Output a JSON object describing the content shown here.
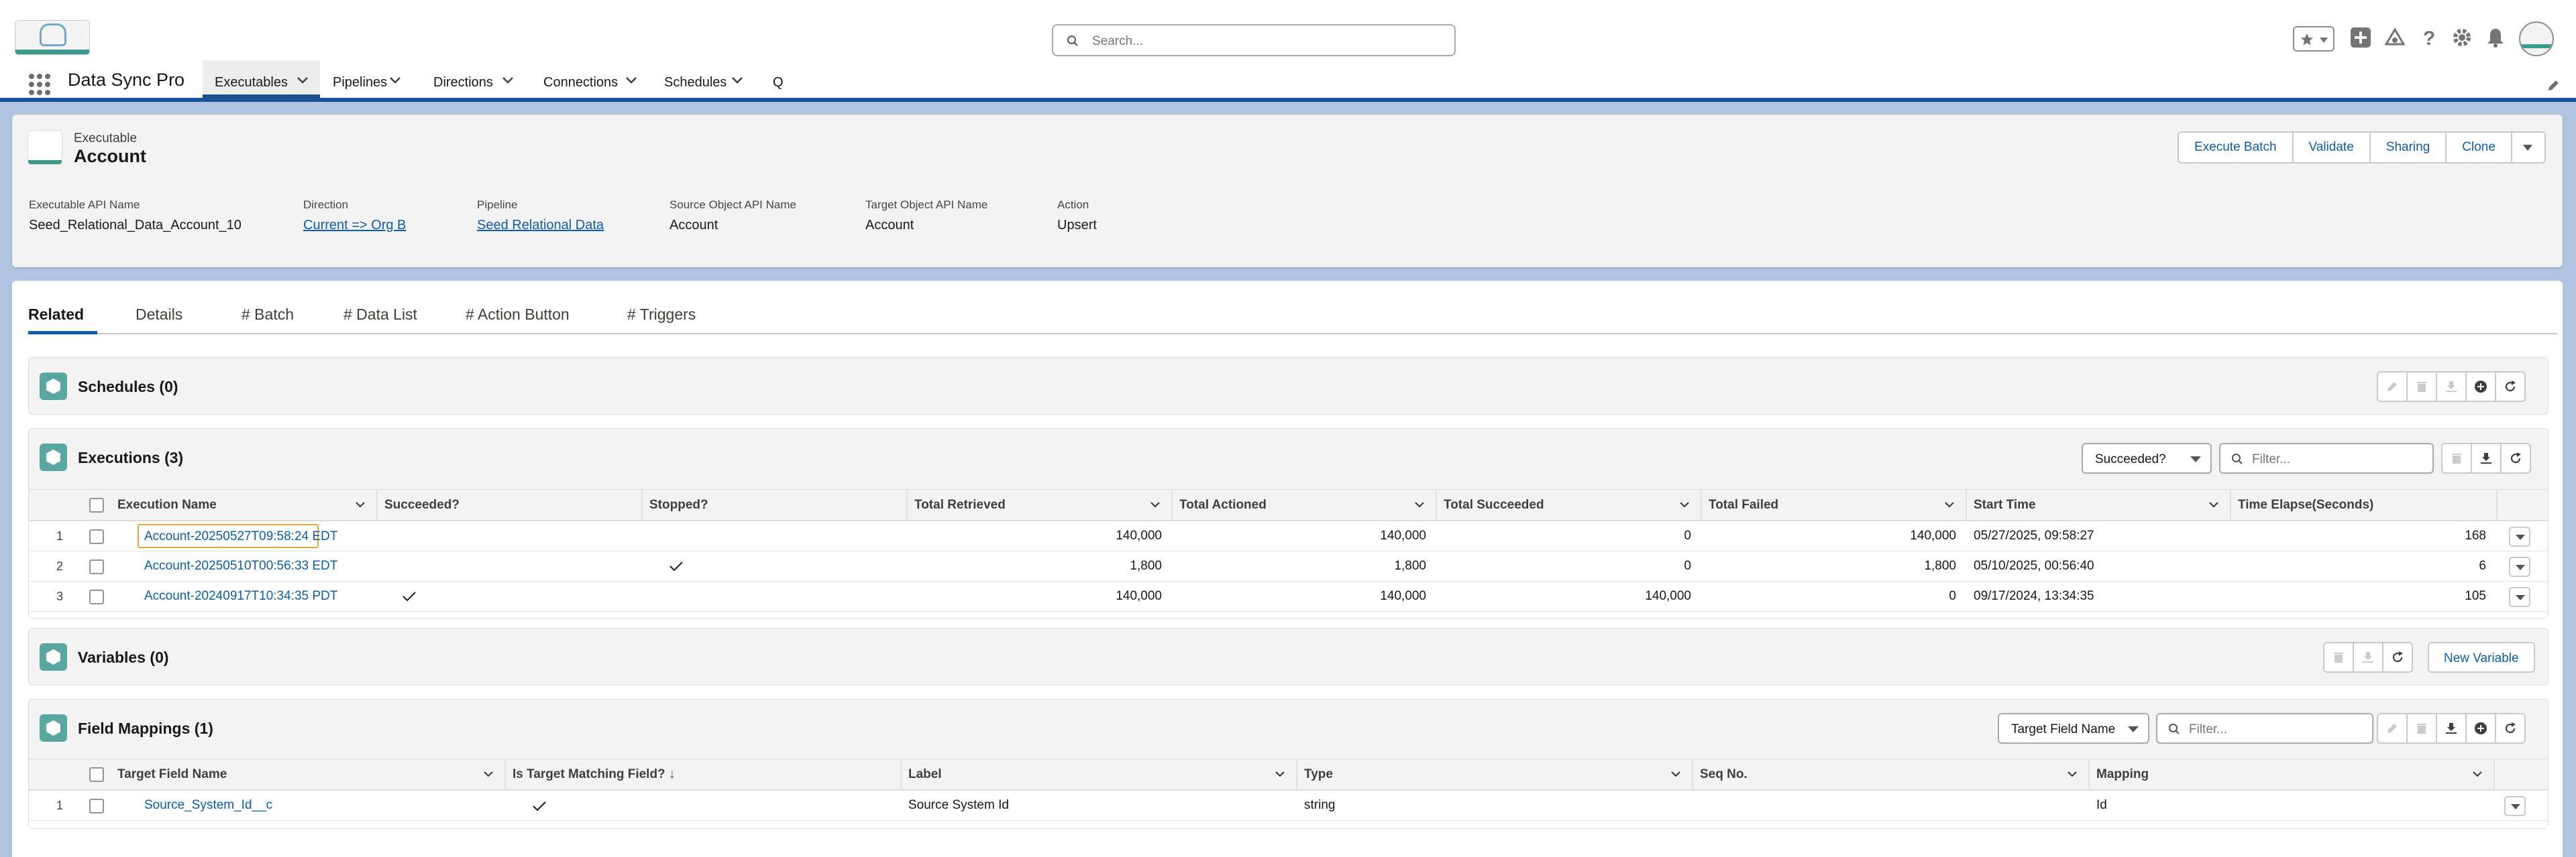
{
  "global_header": {
    "search_placeholder": "Search...",
    "icons": [
      "favorites-star-icon",
      "add-icon",
      "trailhead-icon",
      "help-icon",
      "setup-gear-icon",
      "notifications-bell-icon",
      "user-avatar"
    ]
  },
  "nav": {
    "app_name": "Data Sync Pro",
    "items": [
      {
        "label": "Executables",
        "active": true
      },
      {
        "label": "Pipelines"
      },
      {
        "label": "Directions"
      },
      {
        "label": "Connections"
      },
      {
        "label": "Schedules"
      },
      {
        "label": "Q"
      }
    ]
  },
  "record": {
    "type_label": "Executable",
    "title": "Account",
    "actions": [
      "Execute Batch",
      "Validate",
      "Sharing",
      "Clone"
    ],
    "fields": [
      {
        "label": "Executable API Name",
        "value": "Seed_Relational_Data_Account_10"
      },
      {
        "label": "Direction",
        "value": "Current => Org B",
        "link": true
      },
      {
        "label": "Pipeline",
        "value": "Seed Relational Data",
        "link": true
      },
      {
        "label": "Source Object API Name",
        "value": "Account"
      },
      {
        "label": "Target Object API Name",
        "value": "Account"
      },
      {
        "label": "Action",
        "value": "Upsert"
      }
    ]
  },
  "tabs": [
    "Related",
    "Details",
    "# Batch",
    "# Data List",
    "# Action Button",
    "# Triggers"
  ],
  "schedules": {
    "title": "Schedules (0)"
  },
  "executions": {
    "title": "Executions (3)",
    "filter_select": "Succeeded?",
    "filter_placeholder": "Filter...",
    "columns": [
      "Execution Name",
      "Succeeded?",
      "Stopped?",
      "Total Retrieved",
      "Total Actioned",
      "Total Succeeded",
      "Total Failed",
      "Start Time",
      "Time Elapse(Seconds)"
    ],
    "rows": [
      {
        "num": "1",
        "name": "Account-20250527T09:58:24 EDT",
        "succeeded": false,
        "stopped": false,
        "retrieved": "140,000",
        "actioned": "140,000",
        "succeeded_count": "0",
        "failed": "140,000",
        "start": "05/27/2025, 09:58:27",
        "elapsed": "168"
      },
      {
        "num": "2",
        "name": "Account-20250510T00:56:33 EDT",
        "succeeded": false,
        "stopped": true,
        "retrieved": "1,800",
        "actioned": "1,800",
        "succeeded_count": "0",
        "failed": "1,800",
        "start": "05/10/2025, 00:56:40",
        "elapsed": "6"
      },
      {
        "num": "3",
        "name": "Account-20240917T10:34:35 PDT",
        "succeeded": true,
        "stopped": false,
        "retrieved": "140,000",
        "actioned": "140,000",
        "succeeded_count": "140,000",
        "failed": "0",
        "start": "09/17/2024, 13:34:35",
        "elapsed": "105"
      }
    ]
  },
  "variables": {
    "title": "Variables (0)",
    "new_button": "New Variable"
  },
  "field_mappings": {
    "title": "Field Mappings (1)",
    "filter_select": "Target Field Name",
    "filter_placeholder": "Filter...",
    "columns": [
      "Target Field Name",
      "Is Target Matching Field? ↓",
      "Label",
      "Type",
      "Seq No.",
      "Mapping"
    ],
    "rows": [
      {
        "num": "1",
        "target": "Source_System_Id__c",
        "matching": true,
        "label": "Source System Id",
        "type": "string",
        "seq": "",
        "mapping": "Id"
      }
    ]
  }
}
